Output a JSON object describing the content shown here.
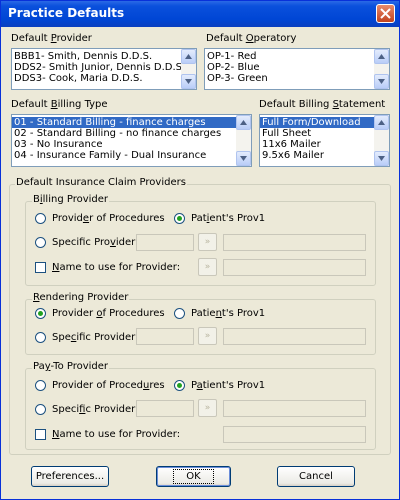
{
  "window": {
    "title": "Practice Defaults"
  },
  "provider": {
    "label_pre": "Default ",
    "label_u": "P",
    "label_post": "rovider",
    "items": [
      "BBB1- Smith, Dennis   D.D.S.",
      "DDS2- Smith Junior, Dennis   D.D.S.",
      "DDS3- Cook, Maria   D.D.S."
    ]
  },
  "operatory": {
    "label_pre": "Default ",
    "label_u": "O",
    "label_post": "peratory",
    "items": [
      "OP-1- Red",
      "OP-2- Blue",
      "OP-3- Green"
    ]
  },
  "billing_type": {
    "label_pre": "Default ",
    "label_u": "B",
    "label_post": "illing Type",
    "items": [
      "01 - Standard Billing - finance charges",
      "02 - Standard Billing - no finance charges",
      "03 - No Insurance",
      "04 - Insurance Family - Dual Insurance"
    ],
    "selected_index": 0
  },
  "billing_statement": {
    "label_pre": "Default Billing ",
    "label_u": "S",
    "label_post": "tatement",
    "items": [
      "Full Form/Download",
      "Full Sheet",
      "11x6 Mailer",
      "9.5x6 Mailer"
    ],
    "selected_index": 0
  },
  "claim_providers": {
    "title": "Default Insurance Claim Providers",
    "billing": {
      "title_pre": "B",
      "title_u": "i",
      "title_post": "lling Provider",
      "procedures_pre": "Provid",
      "procedures_u": "e",
      "procedures_post": "r of Procedures",
      "patients_pre": "Pat",
      "patients_u": "i",
      "patients_post": "ent's Prov1",
      "specific_pre": "Specific Pro",
      "specific_u": "v",
      "specific_post": "ider:",
      "name_pre": "",
      "name_u": "N",
      "name_post": "ame to use for Provider:",
      "selected": "patients_prov1",
      "name_checked": false
    },
    "rendering": {
      "title_pre": "",
      "title_u": "R",
      "title_post": "endering Provider",
      "procedures_pre": "Provider ",
      "procedures_u": "o",
      "procedures_post": "f Procedures",
      "patients_pre": "Patie",
      "patients_u": "n",
      "patients_post": "t's Prov1",
      "specific_pre": "Spe",
      "specific_u": "c",
      "specific_post": "ific Provider:",
      "selected": "provider_of_procedures"
    },
    "payto": {
      "title_pre": "Pa",
      "title_u": "y",
      "title_post": "-To Provider",
      "procedures_pre": "Provider of Proced",
      "procedures_u": "u",
      "procedures_post": "res",
      "patients_pre": "P",
      "patients_u": "a",
      "patients_post": "tient's Prov1",
      "specific_pre": "Speci",
      "specific_u": "f",
      "specific_post": "ic Provider:",
      "name_pre": "",
      "name_u": "N",
      "name_post": "ame to use for Provider:",
      "selected": "patients_prov1",
      "name_checked": false
    },
    "arrow_glyph": "»"
  },
  "buttons": {
    "preferences": "Preferences...",
    "ok": "OK",
    "cancel": "Cancel"
  },
  "colors": {
    "titlebar": "#0046d5",
    "selection": "#316ac5",
    "radio_dot": "#21a121"
  }
}
